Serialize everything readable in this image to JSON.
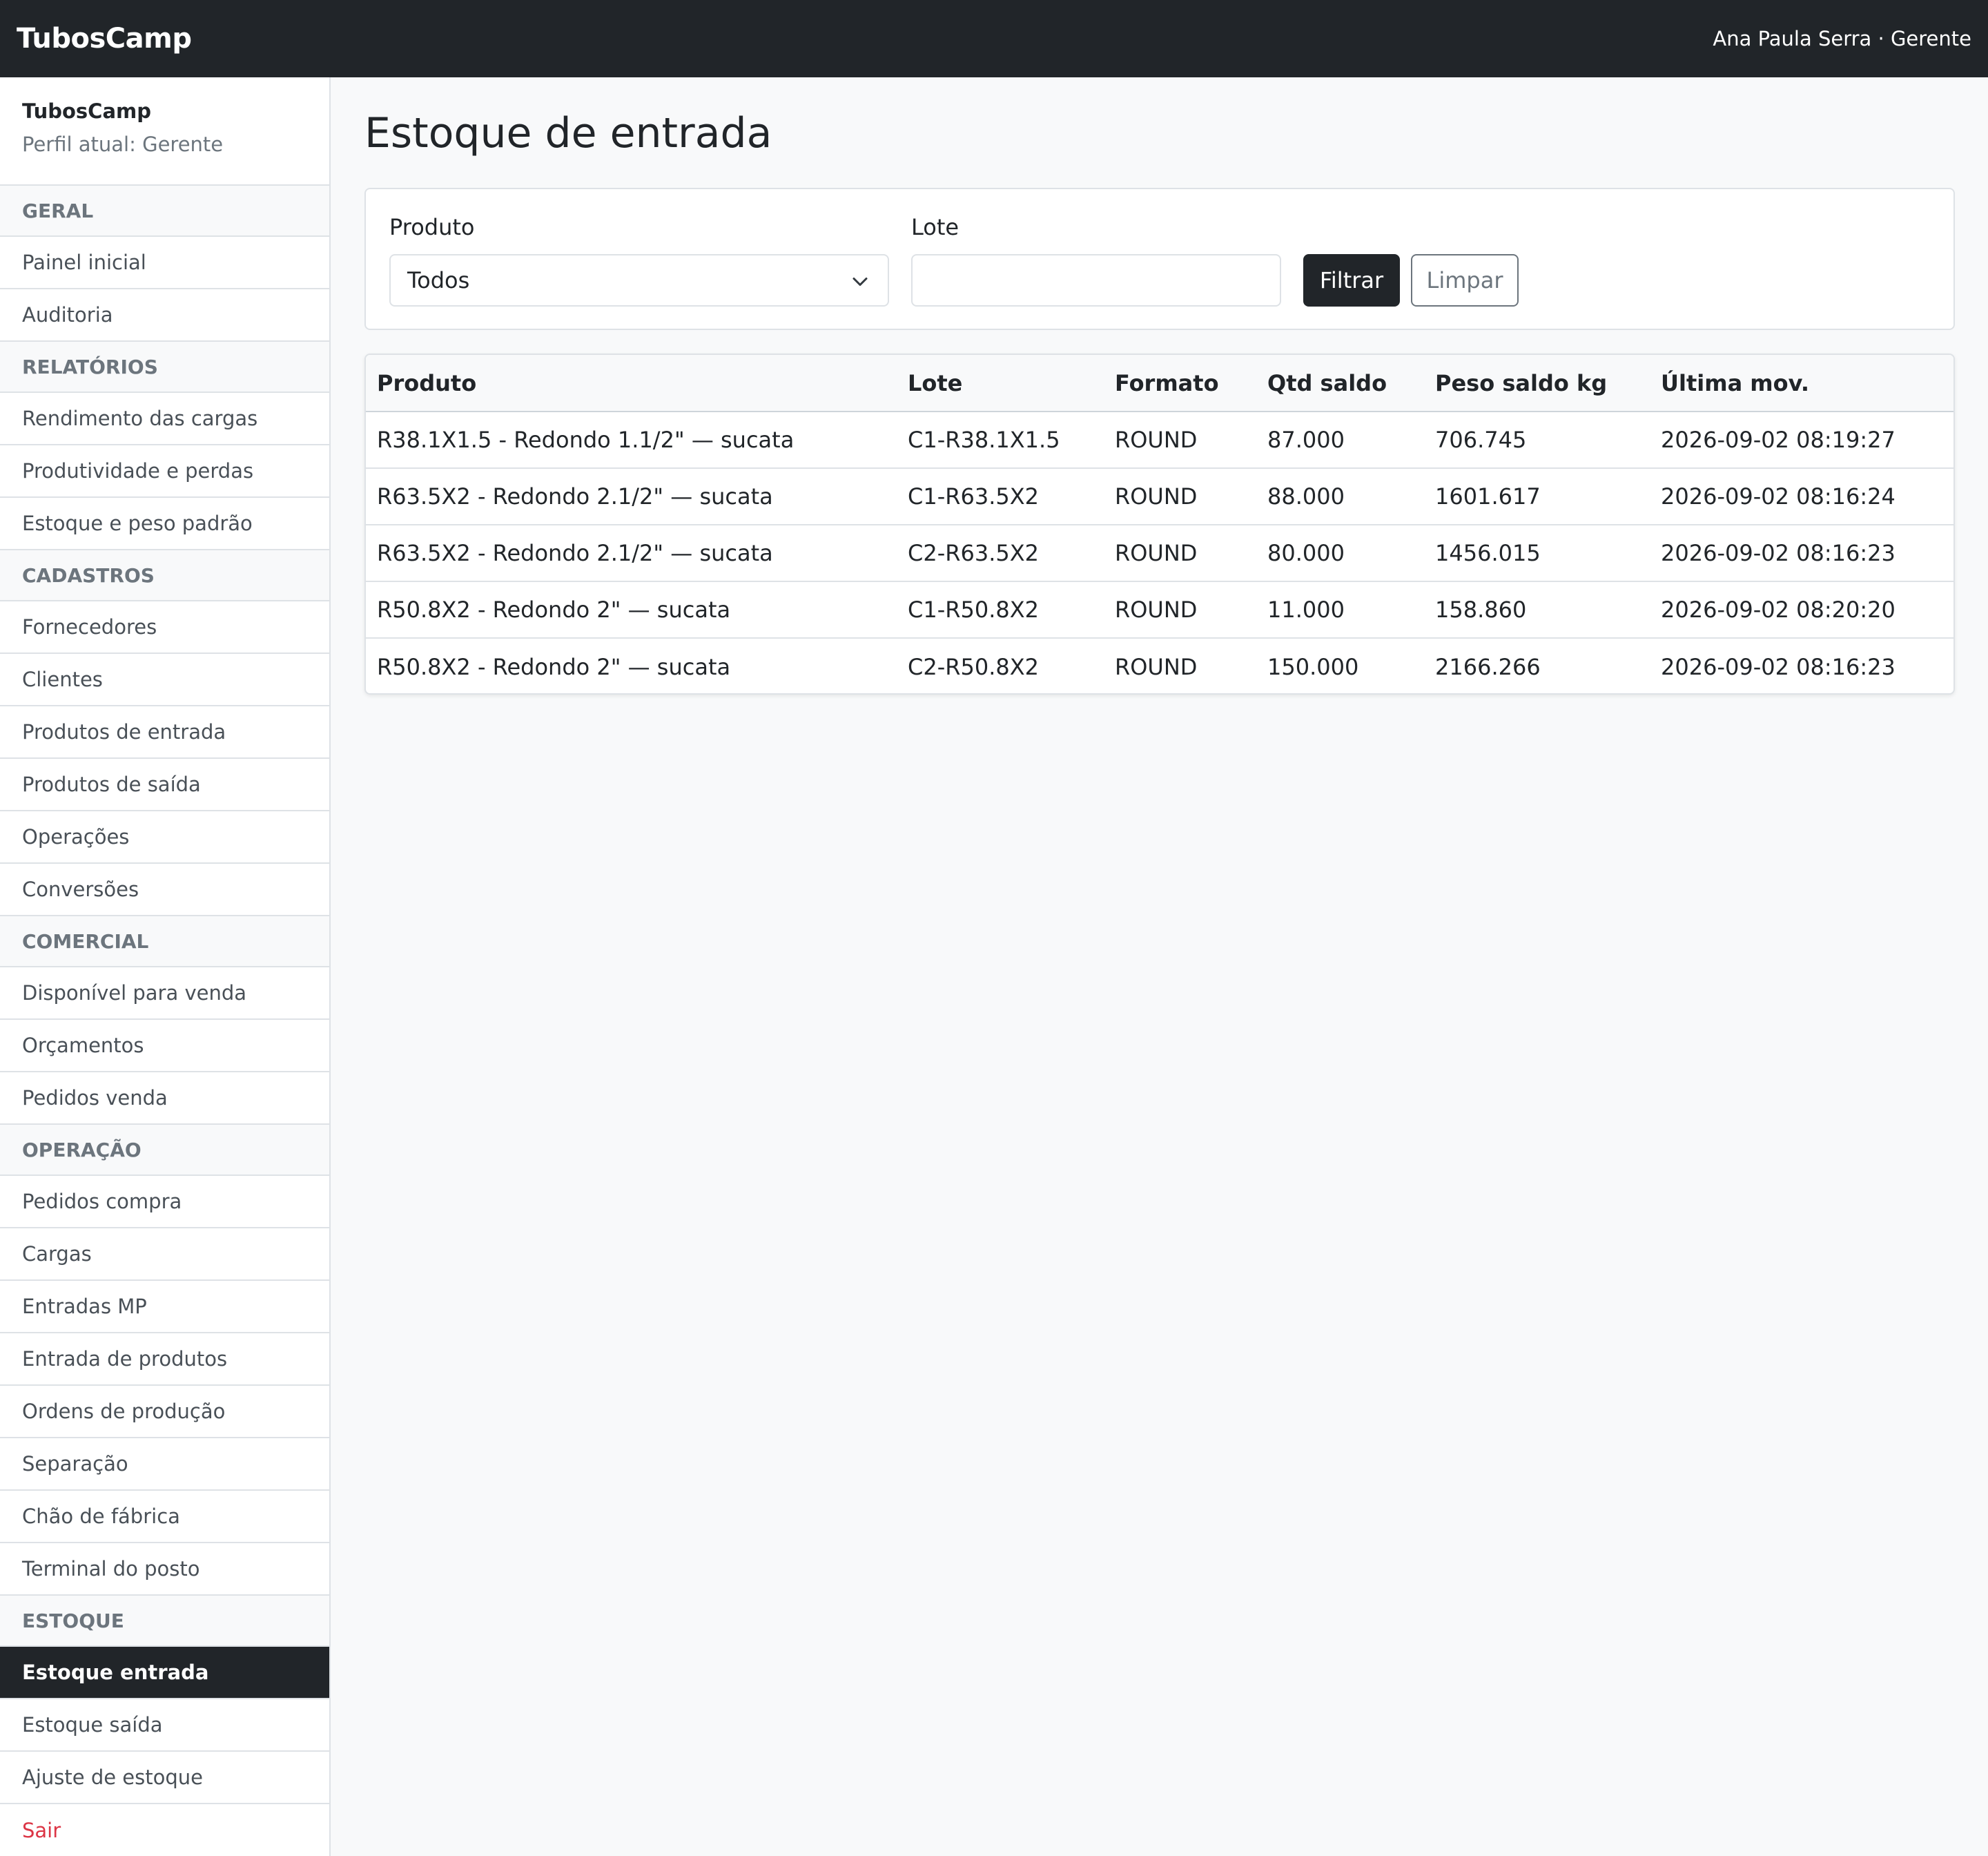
{
  "header": {
    "brand": "TubosCamp",
    "user": "Ana Paula Serra · Gerente"
  },
  "sidebar": {
    "company": "TubosCamp",
    "profile": "Perfil atual: Gerente",
    "groups": [
      {
        "title": "GERAL",
        "items": [
          "Painel inicial",
          "Auditoria"
        ]
      },
      {
        "title": "RELATÓRIOS",
        "items": [
          "Rendimento das cargas",
          "Produtividade e perdas",
          "Estoque e peso padrão"
        ]
      },
      {
        "title": "CADASTROS",
        "items": [
          "Fornecedores",
          "Clientes",
          "Produtos de entrada",
          "Produtos de saída",
          "Operações",
          "Conversões"
        ]
      },
      {
        "title": "COMERCIAL",
        "items": [
          "Disponível para venda",
          "Orçamentos",
          "Pedidos venda"
        ]
      },
      {
        "title": "OPERAÇÃO",
        "items": [
          "Pedidos compra",
          "Cargas",
          "Entradas MP",
          "Entrada de produtos",
          "Ordens de produção",
          "Separação",
          "Chão de fábrica",
          "Terminal do posto"
        ]
      },
      {
        "title": "ESTOQUE",
        "items": [
          "Estoque entrada",
          "Estoque saída",
          "Ajuste de estoque"
        ]
      }
    ],
    "active_item": "Estoque entrada",
    "logout": "Sair"
  },
  "main": {
    "title": "Estoque de entrada",
    "filters": {
      "product_label": "Produto",
      "product_value": "Todos",
      "lot_label": "Lote",
      "lot_value": "",
      "filter_button": "Filtrar",
      "clear_button": "Limpar"
    },
    "table": {
      "columns": [
        "Produto",
        "Lote",
        "Formato",
        "Qtd saldo",
        "Peso saldo kg",
        "Última mov."
      ],
      "rows": [
        [
          "R38.1X1.5 - Redondo 1.1/2\" — sucata",
          "C1-R38.1X1.5",
          "ROUND",
          "87.000",
          "706.745",
          "2026-09-02 08:19:27"
        ],
        [
          "R63.5X2 - Redondo 2.1/2\" — sucata",
          "C1-R63.5X2",
          "ROUND",
          "88.000",
          "1601.617",
          "2026-09-02 08:16:24"
        ],
        [
          "R63.5X2 - Redondo 2.1/2\" — sucata",
          "C2-R63.5X2",
          "ROUND",
          "80.000",
          "1456.015",
          "2026-09-02 08:16:23"
        ],
        [
          "R50.8X2 - Redondo 2\" — sucata",
          "C1-R50.8X2",
          "ROUND",
          "11.000",
          "158.860",
          "2026-09-02 08:20:20"
        ],
        [
          "R50.8X2 - Redondo 2\" — sucata",
          "C2-R50.8X2",
          "ROUND",
          "150.000",
          "2166.266",
          "2026-09-02 08:16:23"
        ]
      ]
    }
  }
}
